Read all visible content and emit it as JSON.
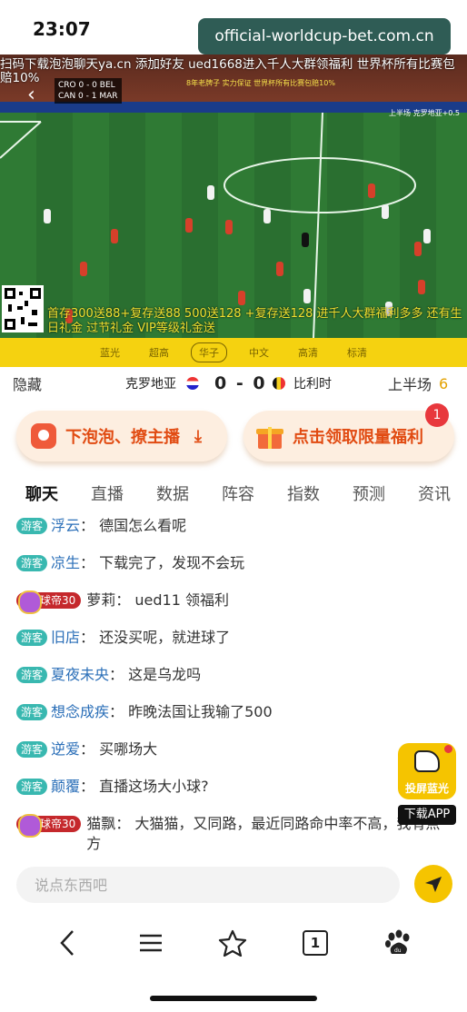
{
  "status_bar": {
    "time": "23:07"
  },
  "url_badge": "official-worldcup-bet.com.cn",
  "video": {
    "top_ticker": "扫码下载泡泡聊天ya.cn 添加好友 ued1668进入千人大群领福利 世界杯所有比赛包赔10%",
    "score_overlay": {
      "line1": "CRO 0 - 0 BEL",
      "line2": "CAN 0 - 1 MAR"
    },
    "promo_overlay": "8年老牌子 实力保证 世界杯所有比赛包赔10%",
    "stream_right": "上半场 克罗地亚+0.5",
    "bottom_ticker": "首存300送88+复存送88 500送128 +复存送128 进千人大群福利多多 还有生日礼金 过节礼金 VIP等级礼金送"
  },
  "quality_options": [
    "蓝光",
    "超高",
    "华子",
    "中文",
    "高清",
    "标清"
  ],
  "quality_selected": 2,
  "match": {
    "hide_label": "隐藏",
    "team_a": "克罗地亚",
    "score": "0 - 0",
    "team_b": "比利时",
    "half": "上半场",
    "minute": "6"
  },
  "actions": {
    "download_label": "下泡泡、撩主播",
    "welfare_label": "点击领取限量福利",
    "welfare_badge": "1"
  },
  "tabs": [
    "聊天",
    "直播",
    "数据",
    "阵容",
    "指数",
    "预测",
    "资讯"
  ],
  "active_tab": 0,
  "chat": [
    {
      "tag": "游客",
      "vip": false,
      "name": "浮云",
      "text": "德国怎么看呢"
    },
    {
      "tag": "游客",
      "vip": false,
      "name": "凉生",
      "text": "下载完了，发现不会玩"
    },
    {
      "tag": "球帝30",
      "vip": true,
      "name": "萝莉",
      "text": "ued11 领福利"
    },
    {
      "tag": "游客",
      "vip": false,
      "name": "旧店",
      "text": "还没买呢，就进球了"
    },
    {
      "tag": "游客",
      "vip": false,
      "name": "夏夜未央",
      "text": "这是乌龙吗"
    },
    {
      "tag": "游客",
      "vip": false,
      "name": "想念成疾",
      "text": "昨晚法国让我输了500"
    },
    {
      "tag": "游客",
      "vip": false,
      "name": "逆爱",
      "text": "买哪场大"
    },
    {
      "tag": "游客",
      "vip": false,
      "name": "颠覆",
      "text": "直播这场大小球?"
    },
    {
      "tag": "球帝30",
      "vip": true,
      "name": "猫飘",
      "text": "大猫猫，又同路，最近同路命中率不高，我有点方"
    }
  ],
  "float_app": {
    "label": "投屏蓝光",
    "download": "下载APP"
  },
  "input": {
    "placeholder": "说点东西吧"
  },
  "navbar": {
    "tab_count": "1"
  },
  "colors": {
    "accent_yellow": "#f5d210",
    "guest_tag": "#39b8b0",
    "vip_tag": "#c5282c",
    "cta_orange": "#e14b12"
  }
}
